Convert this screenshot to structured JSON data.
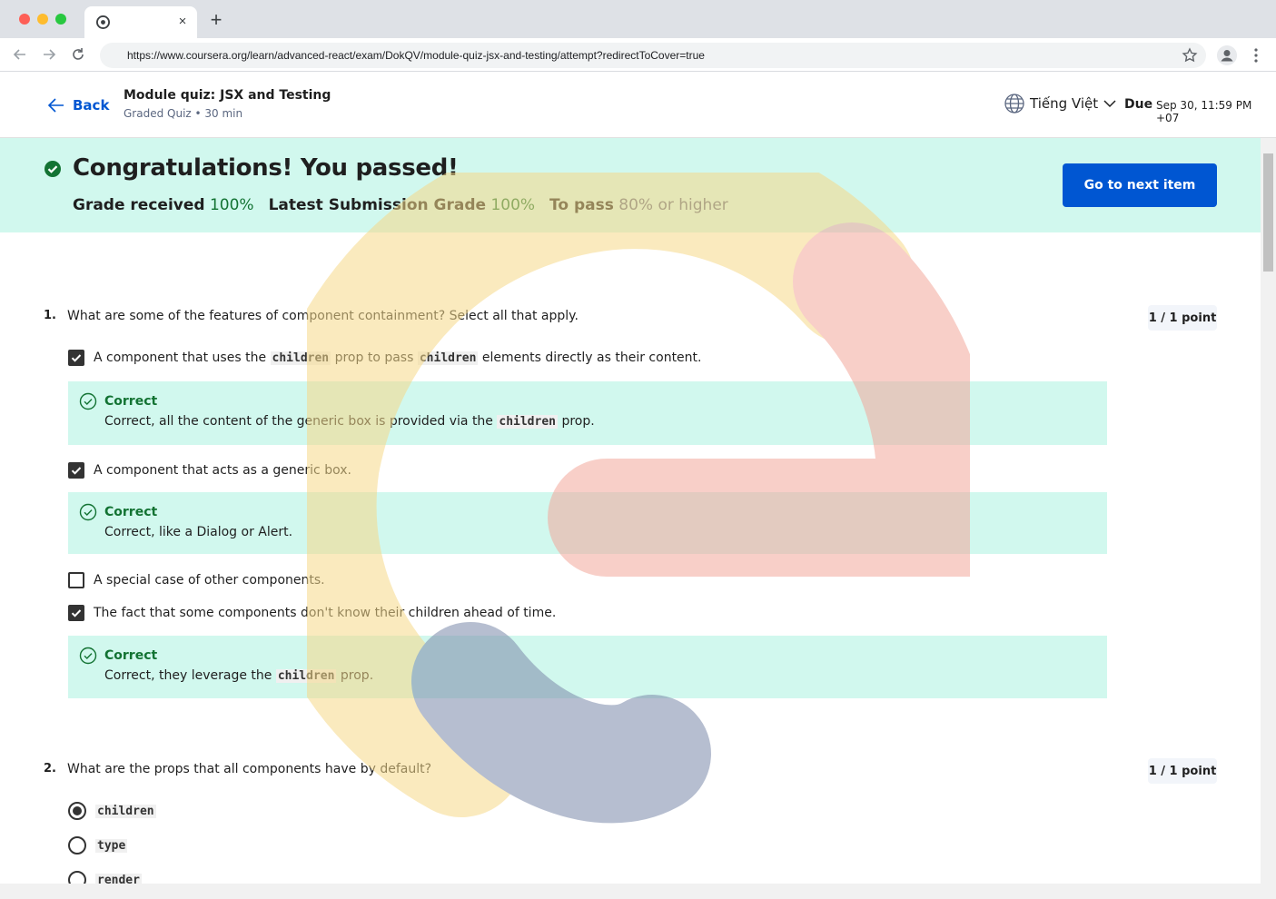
{
  "browser": {
    "url": "https://www.coursera.org/learn/advanced-react/exam/DokQV/module-quiz-jsx-and-testing/attempt?redirectToCover=true",
    "tab_close": "×",
    "new_tab": "+"
  },
  "header": {
    "back_label": "Back",
    "quiz_title": "Module quiz: JSX and Testing",
    "quiz_subtitle": "Graded Quiz • 30 min",
    "language": "Tiếng Việt",
    "due_label": "Due",
    "due_date": "Sep 30, 11:59 PM +07"
  },
  "banner": {
    "title": "Congratulations! You passed!",
    "grade_received_label": "Grade received",
    "grade_received_value": "100%",
    "latest_label": "Latest Submission Grade",
    "latest_value": "100%",
    "pass_label": "To pass",
    "pass_value": "80% or higher",
    "next_button": "Go to next item"
  },
  "questions": [
    {
      "number": "1.",
      "text": "What are some of the features of component containment? Select all that apply.",
      "points": "1 / 1 point",
      "options": [
        {
          "before": "A component that uses the ",
          "code1": "children",
          "middle": " prop to pass ",
          "code2": "children",
          "after": " elements directly as their content.",
          "checked": true
        },
        {
          "text": "A component that acts as a generic box.",
          "checked": true
        },
        {
          "text": "A special case of other components.",
          "checked": false
        },
        {
          "text": "The fact that some components don't know their children ahead of time.",
          "checked": true
        }
      ],
      "feedback": [
        {
          "title": "Correct",
          "before": "Correct, all the content of the generic box is provided via the ",
          "code": "children",
          "after": " prop."
        },
        {
          "title": "Correct",
          "text": "Correct, like a Dialog or Alert."
        },
        {
          "title": "Correct",
          "before": "Correct, they leverage the ",
          "code": "children",
          "after": " prop."
        }
      ]
    },
    {
      "number": "2.",
      "text": "What are the props that all components have by default?",
      "points": "1 / 1 point",
      "options": [
        {
          "code": "children",
          "selected": true
        },
        {
          "code": "type",
          "selected": false
        },
        {
          "code": "render",
          "selected": false
        }
      ]
    }
  ],
  "colors": {
    "accent": "#0056d2",
    "success_bg": "#d1f8ee",
    "success_text": "#137333"
  },
  "icons": [
    "chrome-icon",
    "back-arrow-icon",
    "forward-arrow-icon",
    "reload-icon",
    "star-icon",
    "profile-icon",
    "more-icon",
    "arrow-left-icon",
    "globe-icon",
    "chevron-down-icon",
    "check-circle-icon",
    "check-circle-outline-icon",
    "checkbox-icon",
    "radio-icon"
  ]
}
